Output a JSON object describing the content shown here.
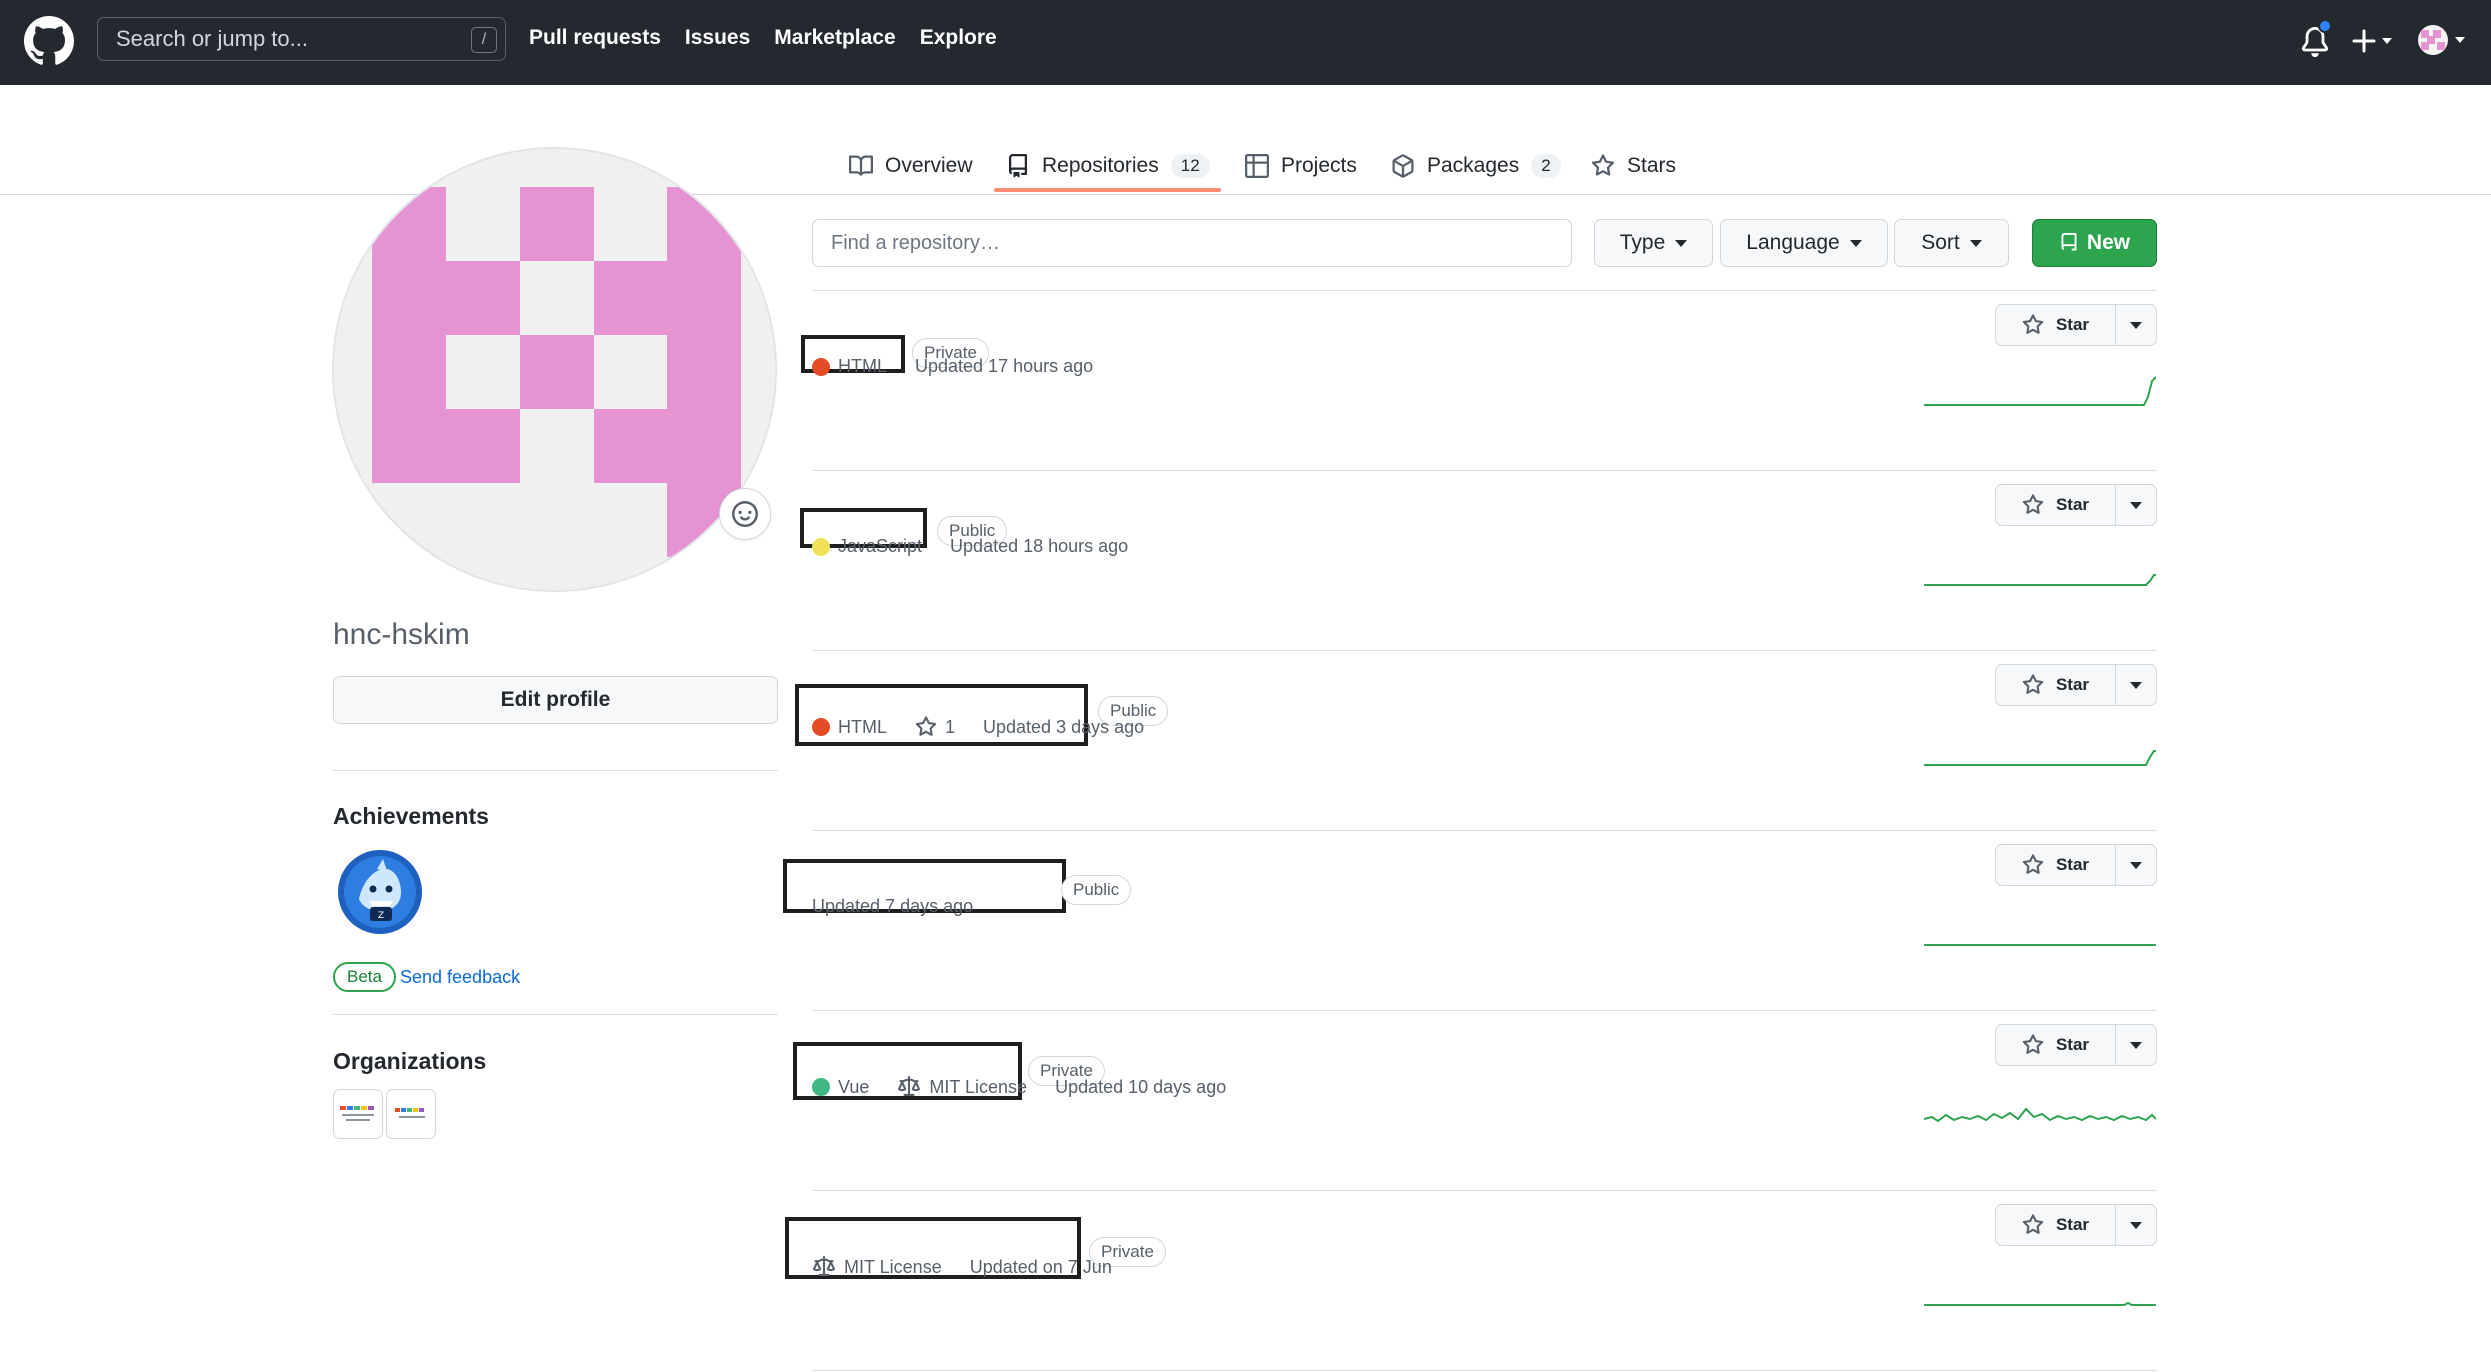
{
  "header": {
    "search_placeholder": "Search or jump to...",
    "slash_key": "/",
    "nav": [
      "Pull requests",
      "Issues",
      "Marketplace",
      "Explore"
    ]
  },
  "tabs": [
    {
      "label": "Overview",
      "icon": "book-icon"
    },
    {
      "label": "Repositories",
      "icon": "repo-icon",
      "count": "12",
      "selected": true
    },
    {
      "label": "Projects",
      "icon": "table-icon"
    },
    {
      "label": "Packages",
      "icon": "package-icon",
      "count": "2"
    },
    {
      "label": "Stars",
      "icon": "star-icon"
    }
  ],
  "profile": {
    "username": "hnc-hskim",
    "edit_label": "Edit profile",
    "achievements_title": "Achievements",
    "beta_label": "Beta",
    "feedback_label": "Send feedback",
    "organizations_title": "Organizations"
  },
  "toolbar": {
    "find_placeholder": "Find a repository…",
    "type_label": "Type",
    "language_label": "Language",
    "sort_label": "Sort",
    "new_label": "New"
  },
  "repos": [
    {
      "visibility": "Private",
      "language": "HTML",
      "language_color": "#e34c26",
      "updated": "Updated 17 hours ago",
      "star_label": "Star"
    },
    {
      "visibility": "Public",
      "language": "JavaScript",
      "language_color": "#f1e05a",
      "updated": "Updated 18 hours ago",
      "star_label": "Star"
    },
    {
      "visibility": "Public",
      "language": "HTML",
      "language_color": "#e34c26",
      "stars": "1",
      "updated": "Updated 3 days ago",
      "star_label": "Star"
    },
    {
      "visibility": "Public",
      "updated": "Updated 7 days ago",
      "star_label": "Star"
    },
    {
      "visibility": "Private",
      "language": "Vue",
      "language_color": "#41b883",
      "license": "MIT License",
      "updated": "Updated 10 days ago",
      "star_label": "Star"
    },
    {
      "visibility": "Private",
      "license": "MIT License",
      "updated": "Updated on 7 Jun",
      "star_label": "Star"
    }
  ],
  "colors": {
    "header_bg": "#24292f",
    "accent_green": "#2da44e",
    "tab_underline": "#fd8c73",
    "avatar_pink": "#e693d2",
    "sparkline": "#2da44e"
  }
}
